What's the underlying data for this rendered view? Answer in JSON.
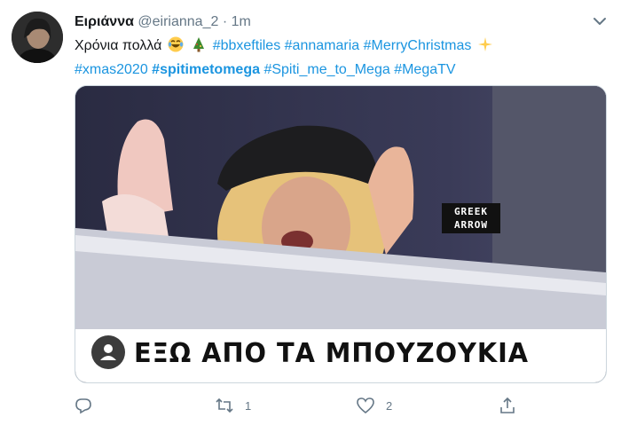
{
  "tweet": {
    "display_name": "Ειριάννα",
    "handle": "@eirianna_2",
    "separator": "·",
    "time": "1m",
    "text_intro": "Χρόνια πολλά",
    "hashtags_line1": [
      "#bbxeftiles",
      "#annamaria",
      "#MerryChristmas"
    ],
    "hashtags_line2": [
      "#xmas2020",
      "#spitimetomega",
      "#Spiti_me_to_Mega",
      "#MegaTV"
    ],
    "emojis": [
      "laughing-crying-emoji",
      "christmas-tree-emoji",
      "sparkle-emoji"
    ]
  },
  "media": {
    "watermark_line1": "GREEK",
    "watermark_line2": "ARROW",
    "caption": "ΕΞΩ ΑΠΟ ΤΑ ΜΠΟΥΖΟΥΚΙΑ"
  },
  "actions": {
    "reply_count": "",
    "retweet_count": "1",
    "like_count": "2",
    "share_count": ""
  },
  "colors": {
    "link": "#1b95e0",
    "muted": "#657786",
    "border": "#ccd6dd"
  }
}
